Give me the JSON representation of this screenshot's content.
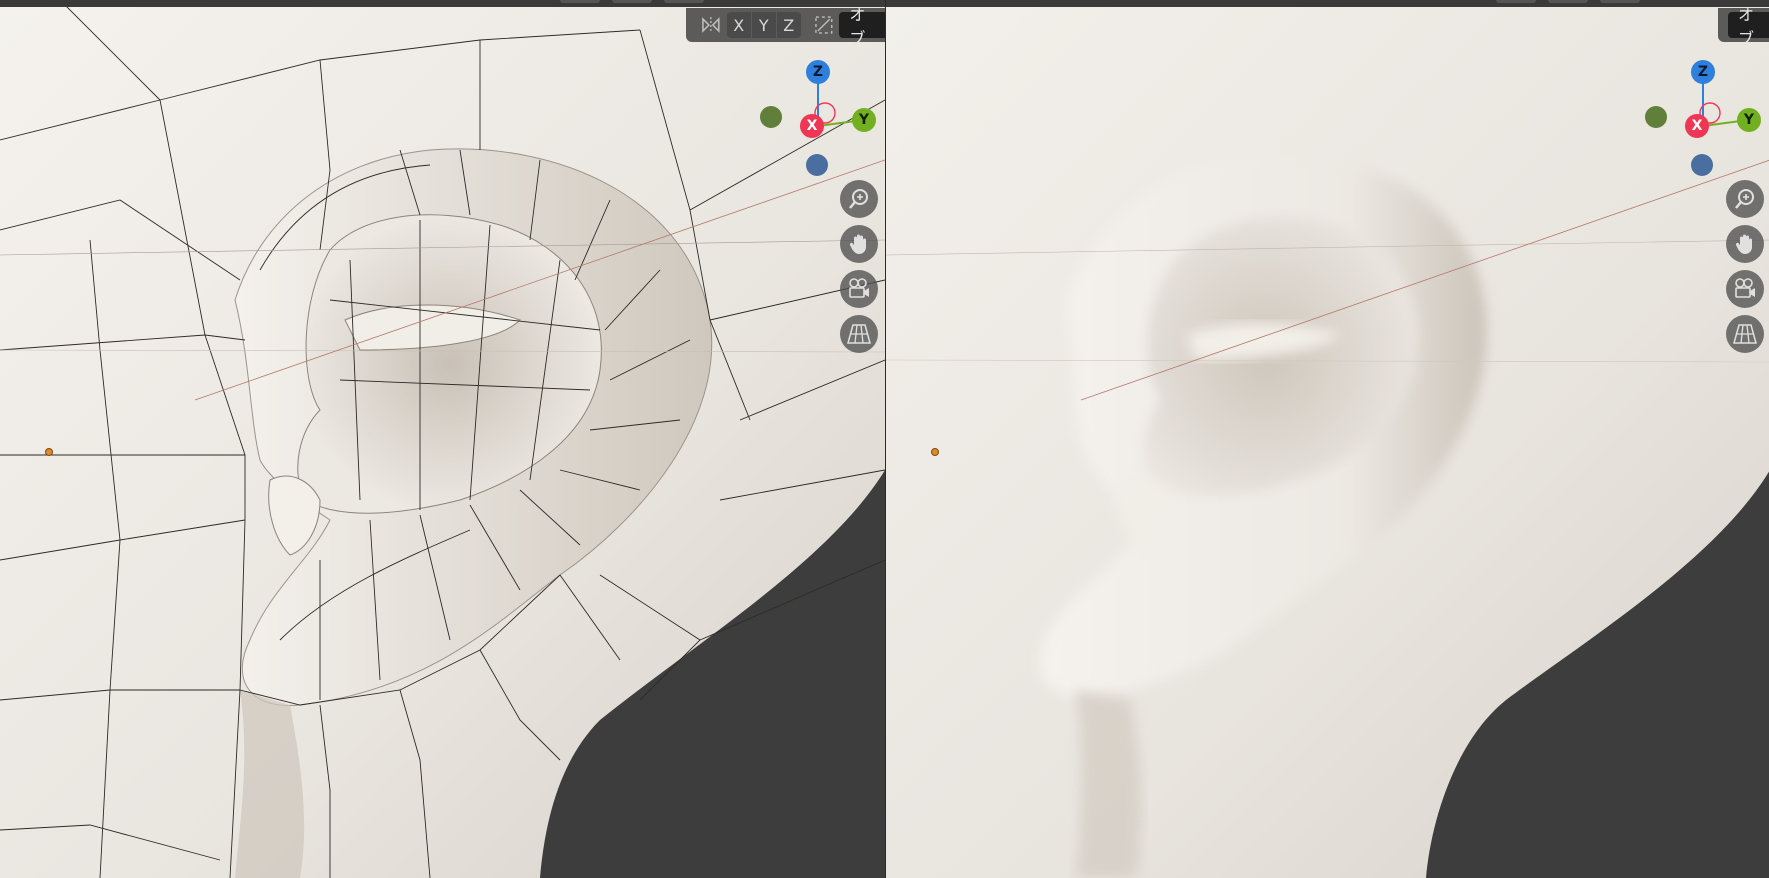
{
  "header": {
    "axis_buttons": [
      "X",
      "Y",
      "Z"
    ],
    "mode_label": "オブ",
    "icons": [
      "mirror-icon",
      "proportional-edit-icon"
    ]
  },
  "gizmo": {
    "z_label": "Z",
    "x_label": "X",
    "y_label": "Y",
    "colors": {
      "x": "#ef3655",
      "y": "#72b021",
      "z": "#2f7fdc"
    }
  },
  "navigation": {
    "icons": [
      "zoom-icon",
      "pan-hand-icon",
      "camera-view-icon",
      "perspective-grid-icon"
    ]
  },
  "viewports": [
    {
      "name": "left",
      "shading": "solid-wireframe"
    },
    {
      "name": "right",
      "shading": "solid-smooth"
    }
  ],
  "colors": {
    "background": "#3d3d3d",
    "mesh": "#e8e4de",
    "origin": "#e08a27"
  }
}
